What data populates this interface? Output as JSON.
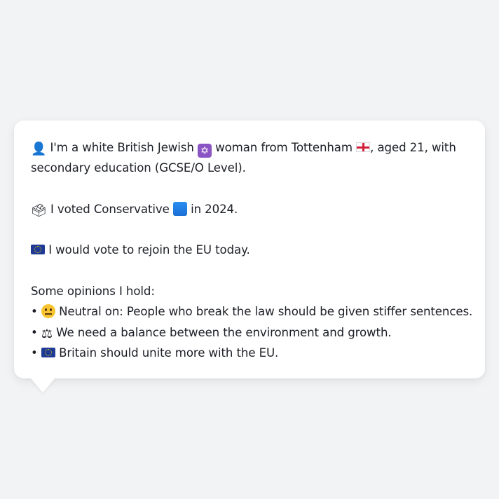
{
  "profile": {
    "intro_part1": "I'm a white British Jewish",
    "intro_part2": "woman from Tottenham",
    "intro_part3": ", aged 21, with",
    "intro_line2": "secondary education (GCSE/O Level).",
    "vote_part1": "I voted Conservative",
    "vote_part2": "in 2024.",
    "eu_statement": "I would vote to rejoin the EU today.",
    "opinions_heading": "Some opinions I hold:",
    "opinions": [
      {
        "icon": "neutral-face-icon",
        "text": "Neutral on: People who break the law should be given stiffer sentences."
      },
      {
        "icon": "balance-scale-icon",
        "text": "We need a balance between the environment and growth."
      },
      {
        "icon": "eu-flag-icon",
        "text": "Britain should unite more with the EU."
      }
    ],
    "bullet": "•"
  },
  "icons": {
    "person": "bust-in-silhouette-icon",
    "religion": "star-of-david-icon",
    "location": "england-flag-icon",
    "ballot": "ballot-box-icon",
    "party": "blue-square-icon",
    "eu": "eu-flag-icon"
  },
  "colors": {
    "background": "#f2f3f5",
    "bubble": "#ffffff",
    "text": "#1c1f26",
    "party_blue": "#1a6fd6"
  }
}
